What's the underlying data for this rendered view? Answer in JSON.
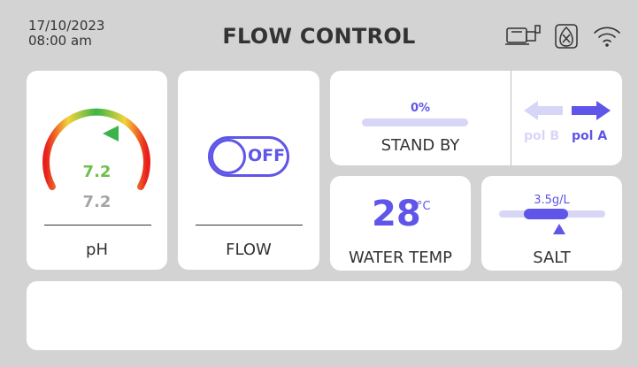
{
  "header": {
    "date": "17/10/2023",
    "time": "08:00 am",
    "title": "FLOW CONTROL",
    "icons": [
      "pump-icon",
      "filter-icon",
      "wifi-icon"
    ]
  },
  "ph": {
    "measured": "7.2",
    "setpoint": "7.2",
    "label": "pH",
    "colors": {
      "value": "#6cc04a",
      "setpoint": "#a5a5a5"
    }
  },
  "flow": {
    "state": "OFF",
    "label": "FLOW"
  },
  "standby": {
    "percent": "0%",
    "progress_value": 0,
    "label": "STAND BY"
  },
  "polarity": {
    "pol_b": "pol B",
    "pol_a": "pol A",
    "active": "pol A"
  },
  "water_temp": {
    "value": "28",
    "unit": "°C",
    "label": "WATER TEMP"
  },
  "salt": {
    "value": "3.5g/L",
    "label": "SALT"
  },
  "colors": {
    "accent": "#5f55e8",
    "accent_light": "#d8d6f6",
    "background": "#d3d3d3"
  }
}
